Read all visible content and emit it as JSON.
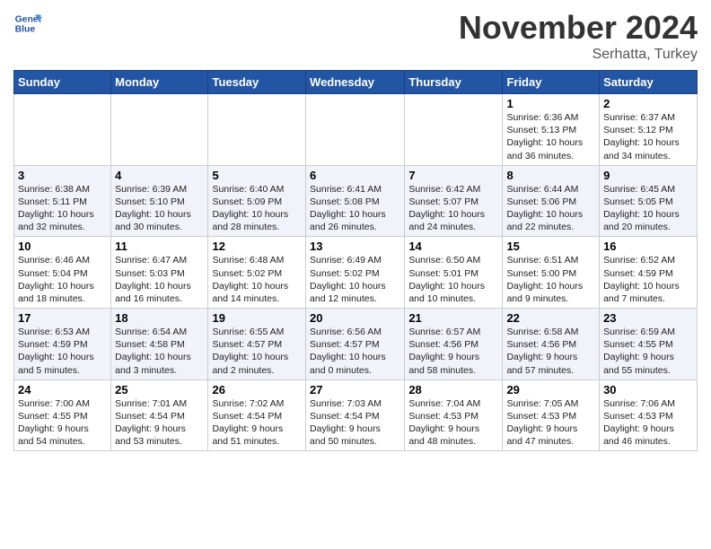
{
  "logo": {
    "line1": "General",
    "line2": "Blue"
  },
  "title": "November 2024",
  "location": "Serhatta, Turkey",
  "days_of_week": [
    "Sunday",
    "Monday",
    "Tuesday",
    "Wednesday",
    "Thursday",
    "Friday",
    "Saturday"
  ],
  "weeks": [
    {
      "cells": [
        {
          "day": "",
          "info": ""
        },
        {
          "day": "",
          "info": ""
        },
        {
          "day": "",
          "info": ""
        },
        {
          "day": "",
          "info": ""
        },
        {
          "day": "",
          "info": ""
        },
        {
          "day": "1",
          "info": "Sunrise: 6:36 AM\nSunset: 5:13 PM\nDaylight: 10 hours\nand 36 minutes."
        },
        {
          "day": "2",
          "info": "Sunrise: 6:37 AM\nSunset: 5:12 PM\nDaylight: 10 hours\nand 34 minutes."
        }
      ]
    },
    {
      "cells": [
        {
          "day": "3",
          "info": "Sunrise: 6:38 AM\nSunset: 5:11 PM\nDaylight: 10 hours\nand 32 minutes."
        },
        {
          "day": "4",
          "info": "Sunrise: 6:39 AM\nSunset: 5:10 PM\nDaylight: 10 hours\nand 30 minutes."
        },
        {
          "day": "5",
          "info": "Sunrise: 6:40 AM\nSunset: 5:09 PM\nDaylight: 10 hours\nand 28 minutes."
        },
        {
          "day": "6",
          "info": "Sunrise: 6:41 AM\nSunset: 5:08 PM\nDaylight: 10 hours\nand 26 minutes."
        },
        {
          "day": "7",
          "info": "Sunrise: 6:42 AM\nSunset: 5:07 PM\nDaylight: 10 hours\nand 24 minutes."
        },
        {
          "day": "8",
          "info": "Sunrise: 6:44 AM\nSunset: 5:06 PM\nDaylight: 10 hours\nand 22 minutes."
        },
        {
          "day": "9",
          "info": "Sunrise: 6:45 AM\nSunset: 5:05 PM\nDaylight: 10 hours\nand 20 minutes."
        }
      ]
    },
    {
      "cells": [
        {
          "day": "10",
          "info": "Sunrise: 6:46 AM\nSunset: 5:04 PM\nDaylight: 10 hours\nand 18 minutes."
        },
        {
          "day": "11",
          "info": "Sunrise: 6:47 AM\nSunset: 5:03 PM\nDaylight: 10 hours\nand 16 minutes."
        },
        {
          "day": "12",
          "info": "Sunrise: 6:48 AM\nSunset: 5:02 PM\nDaylight: 10 hours\nand 14 minutes."
        },
        {
          "day": "13",
          "info": "Sunrise: 6:49 AM\nSunset: 5:02 PM\nDaylight: 10 hours\nand 12 minutes."
        },
        {
          "day": "14",
          "info": "Sunrise: 6:50 AM\nSunset: 5:01 PM\nDaylight: 10 hours\nand 10 minutes."
        },
        {
          "day": "15",
          "info": "Sunrise: 6:51 AM\nSunset: 5:00 PM\nDaylight: 10 hours\nand 9 minutes."
        },
        {
          "day": "16",
          "info": "Sunrise: 6:52 AM\nSunset: 4:59 PM\nDaylight: 10 hours\nand 7 minutes."
        }
      ]
    },
    {
      "cells": [
        {
          "day": "17",
          "info": "Sunrise: 6:53 AM\nSunset: 4:59 PM\nDaylight: 10 hours\nand 5 minutes."
        },
        {
          "day": "18",
          "info": "Sunrise: 6:54 AM\nSunset: 4:58 PM\nDaylight: 10 hours\nand 3 minutes."
        },
        {
          "day": "19",
          "info": "Sunrise: 6:55 AM\nSunset: 4:57 PM\nDaylight: 10 hours\nand 2 minutes."
        },
        {
          "day": "20",
          "info": "Sunrise: 6:56 AM\nSunset: 4:57 PM\nDaylight: 10 hours\nand 0 minutes."
        },
        {
          "day": "21",
          "info": "Sunrise: 6:57 AM\nSunset: 4:56 PM\nDaylight: 9 hours\nand 58 minutes."
        },
        {
          "day": "22",
          "info": "Sunrise: 6:58 AM\nSunset: 4:56 PM\nDaylight: 9 hours\nand 57 minutes."
        },
        {
          "day": "23",
          "info": "Sunrise: 6:59 AM\nSunset: 4:55 PM\nDaylight: 9 hours\nand 55 minutes."
        }
      ]
    },
    {
      "cells": [
        {
          "day": "24",
          "info": "Sunrise: 7:00 AM\nSunset: 4:55 PM\nDaylight: 9 hours\nand 54 minutes."
        },
        {
          "day": "25",
          "info": "Sunrise: 7:01 AM\nSunset: 4:54 PM\nDaylight: 9 hours\nand 53 minutes."
        },
        {
          "day": "26",
          "info": "Sunrise: 7:02 AM\nSunset: 4:54 PM\nDaylight: 9 hours\nand 51 minutes."
        },
        {
          "day": "27",
          "info": "Sunrise: 7:03 AM\nSunset: 4:54 PM\nDaylight: 9 hours\nand 50 minutes."
        },
        {
          "day": "28",
          "info": "Sunrise: 7:04 AM\nSunset: 4:53 PM\nDaylight: 9 hours\nand 48 minutes."
        },
        {
          "day": "29",
          "info": "Sunrise: 7:05 AM\nSunset: 4:53 PM\nDaylight: 9 hours\nand 47 minutes."
        },
        {
          "day": "30",
          "info": "Sunrise: 7:06 AM\nSunset: 4:53 PM\nDaylight: 9 hours\nand 46 minutes."
        }
      ]
    }
  ]
}
